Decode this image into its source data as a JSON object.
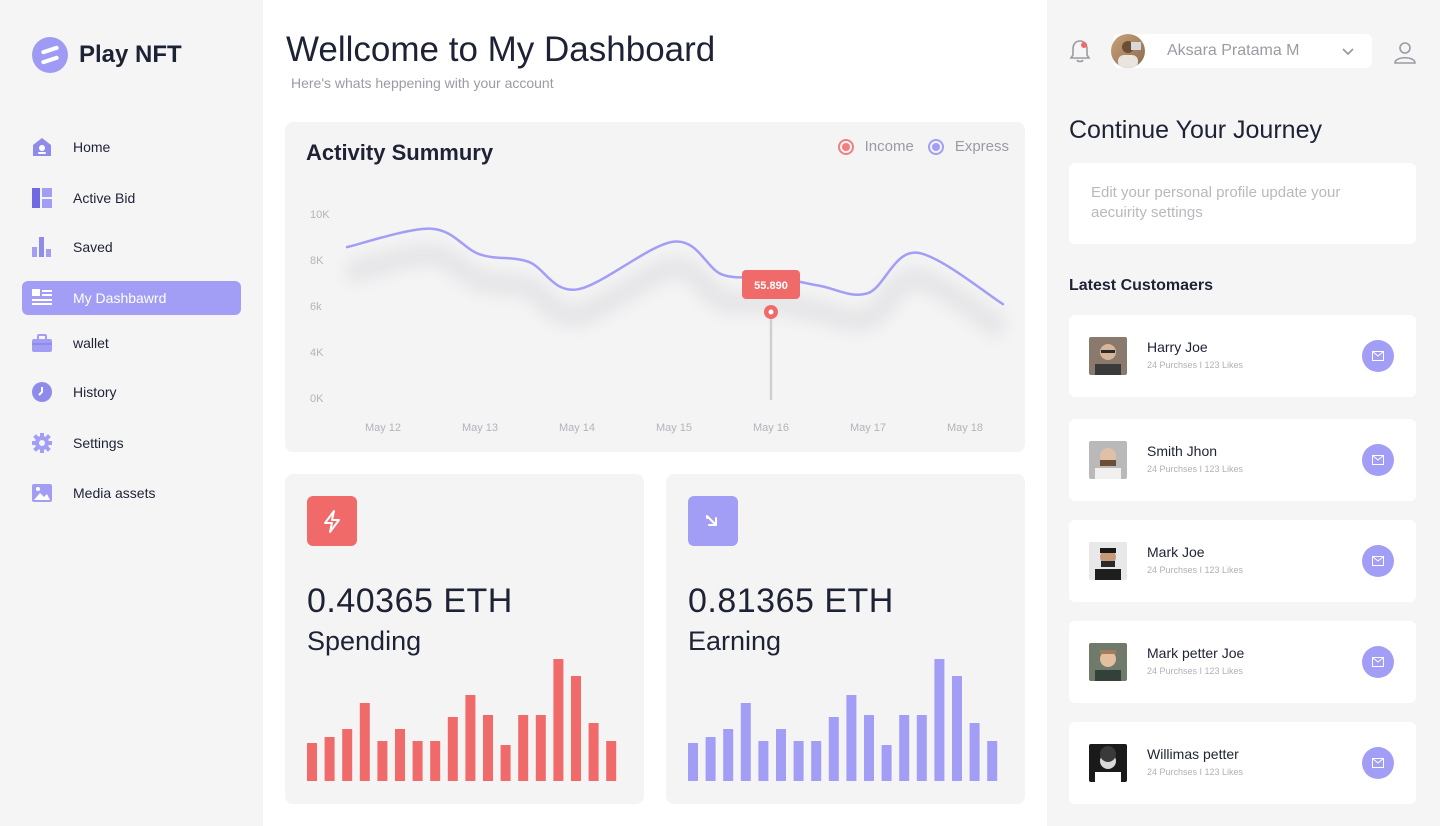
{
  "app": {
    "name": "Play NFT"
  },
  "sidebar": {
    "items": [
      {
        "label": "Home",
        "icon": "home-icon"
      },
      {
        "label": "Active Bid",
        "icon": "layout-icon"
      },
      {
        "label": "Saved",
        "icon": "bar-chart-icon"
      },
      {
        "label": "My Dashbawrd",
        "icon": "dashboard-icon",
        "active": true
      },
      {
        "label": "wallet",
        "icon": "wallet-icon"
      },
      {
        "label": "History",
        "icon": "clock-icon"
      },
      {
        "label": "Settings",
        "icon": "gear-icon"
      },
      {
        "label": "Media assets",
        "icon": "image-icon"
      }
    ]
  },
  "header": {
    "title": "Wellcome to My Dashboard",
    "subtitle": "Here's whats heppening with your account"
  },
  "activity": {
    "title": "Activity Summury",
    "legend": {
      "income": "Income",
      "express": "Express"
    },
    "tooltip": "55.890"
  },
  "chart_data": {
    "type": "line",
    "title": "Activity Summury",
    "categories": [
      "May 12",
      "May 13",
      "May 14",
      "May 15",
      "May 16",
      "May 17",
      "May 18"
    ],
    "y_ticks": [
      "10K",
      "8K",
      "6k",
      "4K",
      "0K"
    ],
    "ylim": [
      0,
      10000
    ],
    "series": [
      {
        "name": "Express",
        "color": "#a29ef6",
        "points": [
          {
            "x": "May 12",
            "y": 8200
          },
          {
            "x": "May 12.5",
            "y": 9200
          },
          {
            "x": "May 13",
            "y": 7800
          },
          {
            "x": "May 13.5",
            "y": 7400
          },
          {
            "x": "May 14",
            "y": 5900
          },
          {
            "x": "May 15",
            "y": 8500
          },
          {
            "x": "May 15.5",
            "y": 6700
          },
          {
            "x": "May 16",
            "y": 6600
          },
          {
            "x": "May 16.5",
            "y": 6100
          },
          {
            "x": "May 17",
            "y": 5700
          },
          {
            "x": "May 17.5",
            "y": 7900
          },
          {
            "x": "May 18",
            "y": 5100
          }
        ]
      }
    ],
    "highlight": {
      "x": "May 16",
      "label": "55.890",
      "color": "#f06a6a"
    },
    "grid": false,
    "legend_position": "top-right"
  },
  "stats": {
    "spending": {
      "value": "0.40365 ETH",
      "label": "Spending",
      "color": "#f06a6a",
      "icon": "lightning-icon",
      "bars": [
        38,
        44,
        52,
        78,
        40,
        52,
        40,
        40,
        64,
        86,
        66,
        36,
        66,
        66,
        122,
        105,
        58,
        40
      ]
    },
    "earning": {
      "value": "0.81365 ETH",
      "label": "Earning",
      "color": "#a29ef6",
      "icon": "arrow-down-left-icon",
      "bars": [
        38,
        44,
        52,
        78,
        40,
        52,
        40,
        40,
        64,
        86,
        66,
        36,
        66,
        66,
        122,
        105,
        58,
        40
      ]
    }
  },
  "user": {
    "name": "Aksara Pratama M"
  },
  "journey": {
    "title": "Continue Your Journey",
    "text": "Edit your personal profile update your aecuirity settings"
  },
  "customers": {
    "title": "Latest Customaers",
    "items": [
      {
        "name": "Harry Joe",
        "meta": "24 Purchses  I  123 Likes"
      },
      {
        "name": "Smith Jhon",
        "meta": "24 Purchses  I  123 Likes"
      },
      {
        "name": "Mark Joe",
        "meta": "24 Purchses  I  123 Likes"
      },
      {
        "name": "Mark petter Joe",
        "meta": "24 Purchses  I  123 Likes"
      },
      {
        "name": "Willimas petter",
        "meta": "24 Purchses  I  123 Likes"
      }
    ]
  }
}
